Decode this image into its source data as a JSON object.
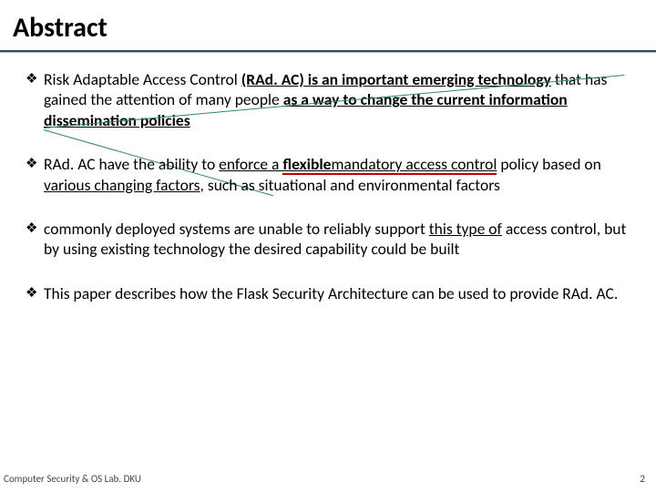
{
  "title": "Abstract",
  "bullets": {
    "glyph": "❖",
    "b1": {
      "p1": "Risk Adaptable Access Control ",
      "p2": "(RAd. AC) is an important emerging technology",
      "p3": " that has gained the attention of many people ",
      "p4": "as a way to change the current information dissemination policies"
    },
    "b2": {
      "p1": "RAd. AC have the ability to ",
      "p2": "enforce a ",
      "flex": "flexible",
      "p3": " mandatory access control",
      "p4": " policy based on ",
      "p5": "various changing factors",
      "p6": ", such as situational and environmental factors"
    },
    "b3": {
      "p1": "commonly deployed systems are unable to reliably support ",
      "p2": "this type of",
      "p3": " access control, but by using existing technology the desired capability could be built"
    },
    "b4": {
      "p1": "This paper describes how the Flask Security Architecture can be used to provide RAd. AC."
    }
  },
  "footer": {
    "left": "Computer Security & OS Lab. DKU",
    "right": "2"
  }
}
